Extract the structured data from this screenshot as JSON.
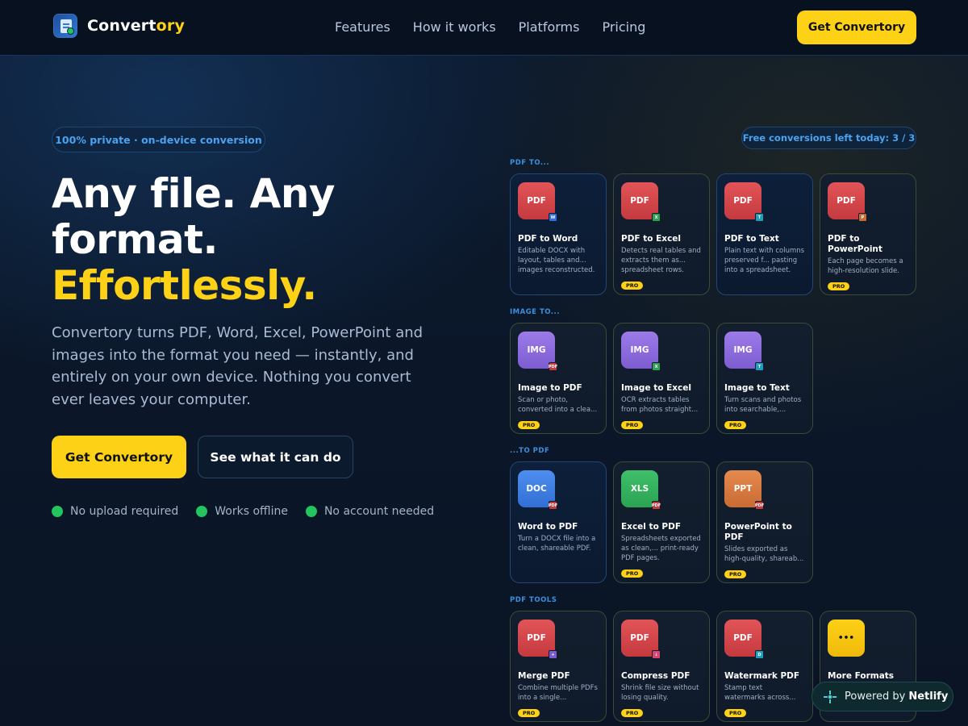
{
  "brand": {
    "name_main": "Convert",
    "name_accent": "ory"
  },
  "nav": {
    "items": [
      "Features",
      "How it works",
      "Platforms",
      "Pricing"
    ]
  },
  "header": {
    "cta": "Get Convertory"
  },
  "hero": {
    "badge": "100% private · on-device conversion",
    "title_line1": "Any file. Any",
    "title_line2": "format.",
    "title_line3": "Effortlessly.",
    "lead": "Convertory turns PDF, Word, Excel, PowerPoint and images into the format you need — instantly, and entirely on your own device. Nothing you convert ever leaves your computer.",
    "primary_button": "Get Convertory",
    "secondary_button": "See what it can do",
    "checks": [
      "No upload required",
      "Works offline",
      "No account needed"
    ]
  },
  "panel": {
    "free_badge": "Free conversions left today: 3 / 3",
    "sections": [
      {
        "label": "PDF TO..."
      },
      {
        "label": "IMAGE TO..."
      },
      {
        "label": "...TO PDF"
      },
      {
        "label": "PDF TOOLS"
      }
    ],
    "pro_label": "PRO",
    "cards": [
      {
        "tile": "PDF",
        "mini": "W",
        "title": "PDF to Word",
        "desc": "Editable DOCX with layout, tables and... images reconstructed."
      },
      {
        "tile": "PDF",
        "mini": "X",
        "title": "PDF to Excel",
        "desc": "Detects real tables and extracts them as... spreadsheet rows."
      },
      {
        "tile": "PDF",
        "mini": "T",
        "title": "PDF to Text",
        "desc": "Plain text with columns preserved f... pasting into a spreadsheet."
      },
      {
        "tile": "PDF",
        "mini": "P",
        "title": "PDF to PowerPoint",
        "desc": "Each page becomes a high-resolution slide."
      },
      {
        "tile": "IMG",
        "mini": "PDF",
        "title": "Image to PDF",
        "desc": "Scan or photo, converted into a clea..."
      },
      {
        "tile": "IMG",
        "mini": "X",
        "title": "Image to Excel",
        "desc": "OCR extracts tables from photos straight..."
      },
      {
        "tile": "IMG",
        "mini": "T",
        "title": "Image to Text",
        "desc": "Turn scans and photos into searchable,..."
      },
      {
        "tile": "DOC",
        "mini": "PDF",
        "title": "Word to PDF",
        "desc": "Turn a DOCX file into a clean, shareable PDF."
      },
      {
        "tile": "XLS",
        "mini": "PDF",
        "title": "Excel to PDF",
        "desc": "Spreadsheets exported as clean,... print-ready PDF pages."
      },
      {
        "tile": "PPT",
        "mini": "PDF",
        "title": "PowerPoint to PDF",
        "desc": "Slides exported as high-quality, shareab..."
      },
      {
        "tile": "PDF",
        "mini": "+",
        "title": "Merge PDF",
        "desc": "Combine multiple PDFs into a single..."
      },
      {
        "tile": "PDF",
        "mini": "↓",
        "title": "Compress PDF",
        "desc": "Shrink file size without losing quality."
      },
      {
        "tile": "PDF",
        "mini": "D",
        "title": "Watermark PDF",
        "desc": "Stamp text watermarks across..."
      },
      {
        "tile": "•••",
        "mini": "",
        "title": "More Formats",
        "desc": ""
      }
    ]
  },
  "netlify": {
    "prefix": "Powered by",
    "name": "Netlify"
  }
}
